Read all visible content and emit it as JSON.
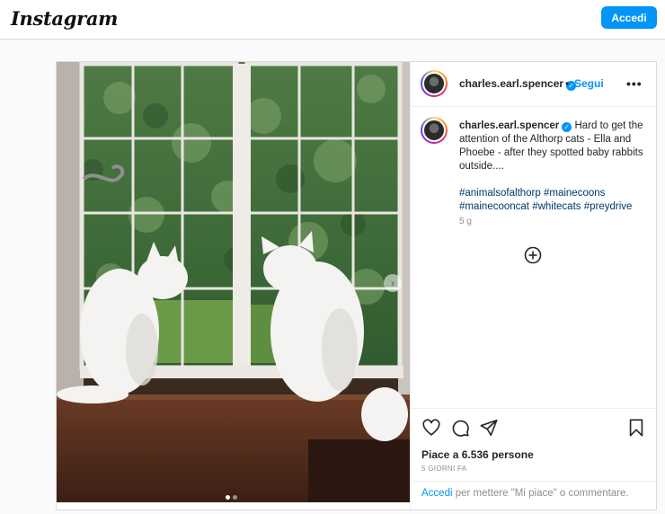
{
  "brand": {
    "logo_text": "Instagram"
  },
  "header": {
    "login_label": "Accedi"
  },
  "post": {
    "username": "charles.earl.spencer",
    "separator": "•",
    "follow_label": "Segui",
    "more_label": "•••",
    "caption_text": "Hard to get the attention of the Althorp cats - Ella and Phoebe - after they spotted baby rabbits outside....",
    "hashtags": "#animalsofalthorp #mainecoons #mainecooncat #whitecats #preydrive",
    "age": "5 g",
    "likes": "Piace a 6.536 persone",
    "posted_ago": "5 GIORNI FA",
    "login_link": "Accedi",
    "login_rest": " per mettere \"Mi piace\" o commentare."
  },
  "carousel": {
    "slides": 2,
    "current": 1
  },
  "icons": [
    "verified-badge-icon",
    "more-options-icon",
    "add-comment-icon",
    "heart-icon",
    "comment-icon",
    "share-icon",
    "bookmark-icon",
    "next-slide-icon"
  ],
  "colors": {
    "accent": "#0095f6",
    "link": "#00376b",
    "muted": "#8e8e8e",
    "border": "#dbdbdb"
  }
}
